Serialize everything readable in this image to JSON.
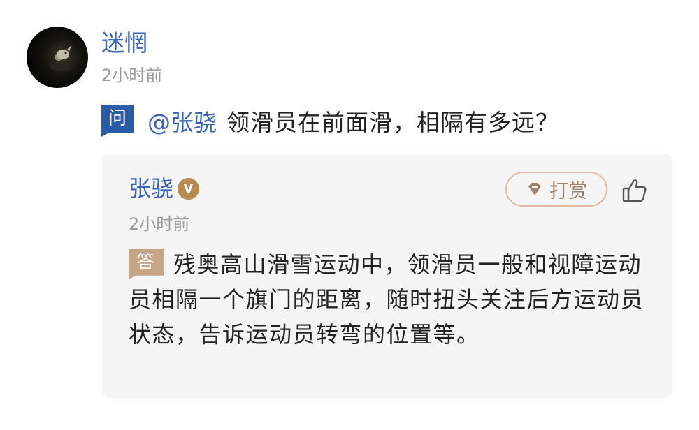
{
  "post": {
    "author": "迷惘",
    "time": "2小时前"
  },
  "question": {
    "badge": "问",
    "mention": "@张骁",
    "text": "领滑员在前面滑，相隔有多远？"
  },
  "answer": {
    "author": "张骁",
    "verified_badge": "V",
    "tip_label": "打赏",
    "time": "2小时前",
    "badge": "答",
    "text": "残奥高山滑雪运动中，领滑员一般和视障运动员相隔一个旗门的距离，随时扭头关注后方运动员状态，告诉运动员转弯的位置等。"
  },
  "colors": {
    "link_blue": "#3a64b8",
    "question_badge": "#2a5ba6",
    "answer_badge": "#c8a487",
    "verified_gold": "#b78a52",
    "tip_border": "#e2b9a3",
    "muted_gray": "#9a9a9a",
    "card_bg": "#f5f5f5"
  },
  "icons": {
    "avatar": "avatar-image",
    "verified": "verified-v-icon",
    "tip": "gem-icon",
    "like": "thumbs-up-icon"
  }
}
